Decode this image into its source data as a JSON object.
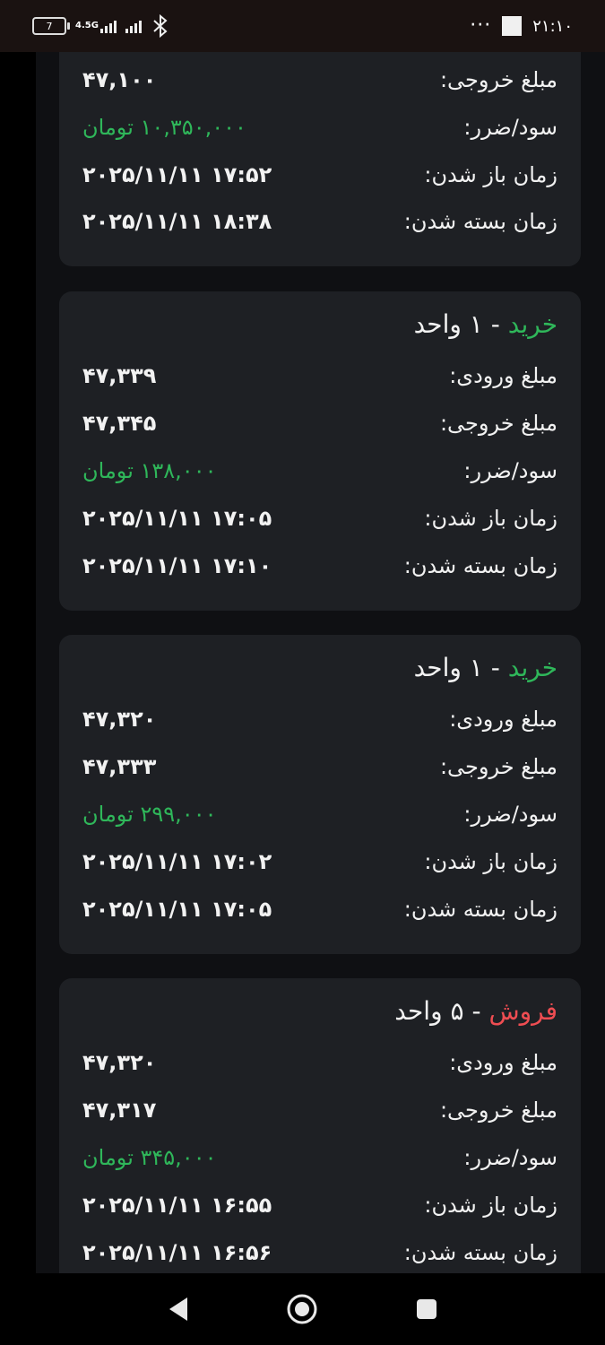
{
  "status_bar": {
    "battery": "7",
    "network": "4.5G",
    "time": "۲۱:۱۰",
    "overflow": "···"
  },
  "labels": {
    "entry": "مبلغ ورودی:",
    "exit": "مبلغ خروجی:",
    "pnl": "سود/ضرر:",
    "open_time": "زمان باز شدن:",
    "close_time": "زمان بسته شدن:"
  },
  "cards": [
    {
      "exit": "۴۷,۱۰۰",
      "pnl": "۱۰,۳۵۰,۰۰۰ تومان",
      "open_time": "۲۰۲۵/۱۱/۱۱ ۱۷:۵۲",
      "close_time": "۲۰۲۵/۱۱/۱۱ ۱۸:۳۸"
    },
    {
      "side": "خرید",
      "quantity": " - ۱ واحد",
      "entry": "۴۷,۳۳۹",
      "exit": "۴۷,۳۴۵",
      "pnl": "۱۳۸,۰۰۰ تومان",
      "open_time": "۲۰۲۵/۱۱/۱۱ ۱۷:۰۵",
      "close_time": "۲۰۲۵/۱۱/۱۱ ۱۷:۱۰"
    },
    {
      "side": "خرید",
      "quantity": " - ۱ واحد",
      "entry": "۴۷,۳۲۰",
      "exit": "۴۷,۳۳۳",
      "pnl": "۲۹۹,۰۰۰ تومان",
      "open_time": "۲۰۲۵/۱۱/۱۱ ۱۷:۰۲",
      "close_time": "۲۰۲۵/۱۱/۱۱ ۱۷:۰۵"
    },
    {
      "side": "فروش",
      "quantity": " - ۵ واحد",
      "entry": "۴۷,۳۲۰",
      "exit": "۴۷,۳۱۷",
      "pnl": "۳۴۵,۰۰۰ تومان",
      "open_time": "۲۰۲۵/۱۱/۱۱ ۱۶:۵۵",
      "close_time": "۲۰۲۵/۱۱/۱۱ ۱۶:۵۶"
    }
  ],
  "colors": {
    "profit": "#2fb75a",
    "buy": "#2fb75a",
    "sell": "#ef4d52",
    "card_bg": "#1e2024",
    "page_bg": "#0f1013"
  },
  "icons": {
    "back": "back-triangle-icon",
    "home": "home-circle-icon",
    "recents": "recents-square-icon"
  }
}
